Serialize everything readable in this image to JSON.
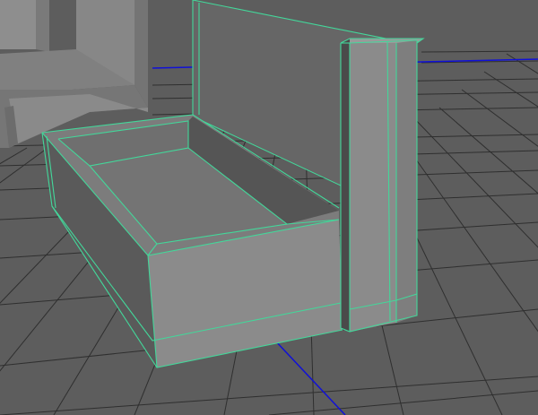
{
  "viewport": {
    "label": "",
    "background_color": "#5d5d5d",
    "grid_color": "#2f2f2f",
    "axis_color": "#1010d8",
    "wireframe_color": "#43d79a",
    "objects": [
      {
        "name": "sofa-back-panel",
        "selected": true
      },
      {
        "name": "sofa-seat-frame",
        "selected": true
      },
      {
        "name": "sofa-arm-post",
        "selected": true
      },
      {
        "name": "background-chair",
        "selected": false
      }
    ]
  }
}
